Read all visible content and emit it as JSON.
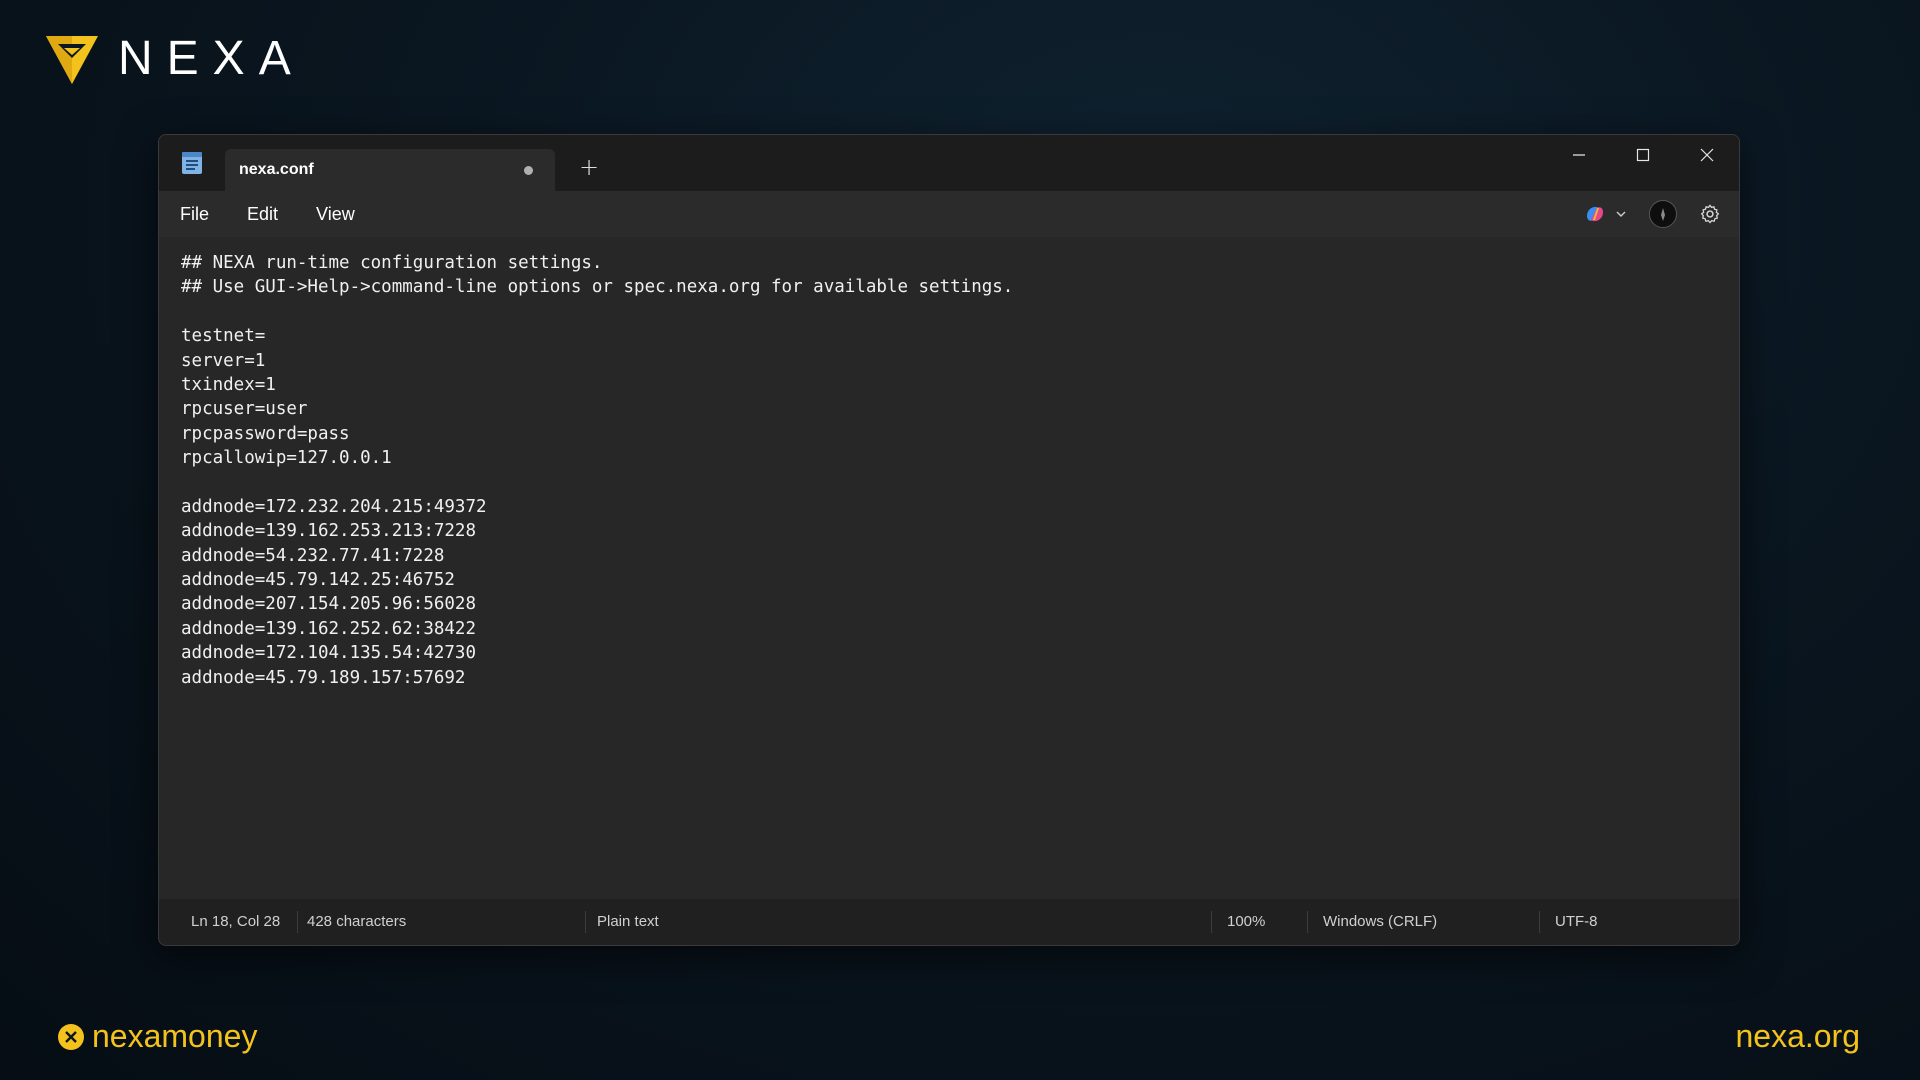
{
  "brand": {
    "name": "NEXA",
    "logo_icon": "nexa-shield-logo-icon",
    "accent_color": "#f4c21c"
  },
  "window": {
    "tab": {
      "title": "nexa.conf",
      "unsaved_indicator": true
    },
    "new_tab_label": "+",
    "controls": [
      "minimize-icon",
      "maximize-icon",
      "close-icon"
    ]
  },
  "menu": {
    "file": "File",
    "edit": "Edit",
    "view": "View",
    "right_icons": [
      "copilot-icon",
      "chevron-down-icon",
      "avatar",
      "gear-icon"
    ]
  },
  "editor": {
    "lines": [
      "## NEXA run-time configuration settings.",
      "## Use GUI->Help->command-line options or spec.nexa.org for available settings.",
      "",
      "testnet=",
      "server=1",
      "txindex=1",
      "rpcuser=user",
      "rpcpassword=pass",
      "rpcallowip=127.0.0.1",
      "",
      "addnode=172.232.204.215:49372",
      "addnode=139.162.253.213:7228",
      "addnode=54.232.77.41:7228",
      "addnode=45.79.142.25:46752",
      "addnode=207.154.205.96:56028",
      "addnode=139.162.252.62:38422",
      "addnode=172.104.135.54:42730",
      "addnode=45.79.189.157:57692"
    ]
  },
  "status": {
    "position": "Ln 18, Col 28",
    "characters": "428 characters",
    "file_type": "Plain text",
    "zoom": "100%",
    "line_ending": "Windows (CRLF)",
    "encoding": "UTF-8"
  },
  "footer": {
    "handle": "nexamoney",
    "handle_icon": "x-logo-icon",
    "website": "nexa.org"
  }
}
